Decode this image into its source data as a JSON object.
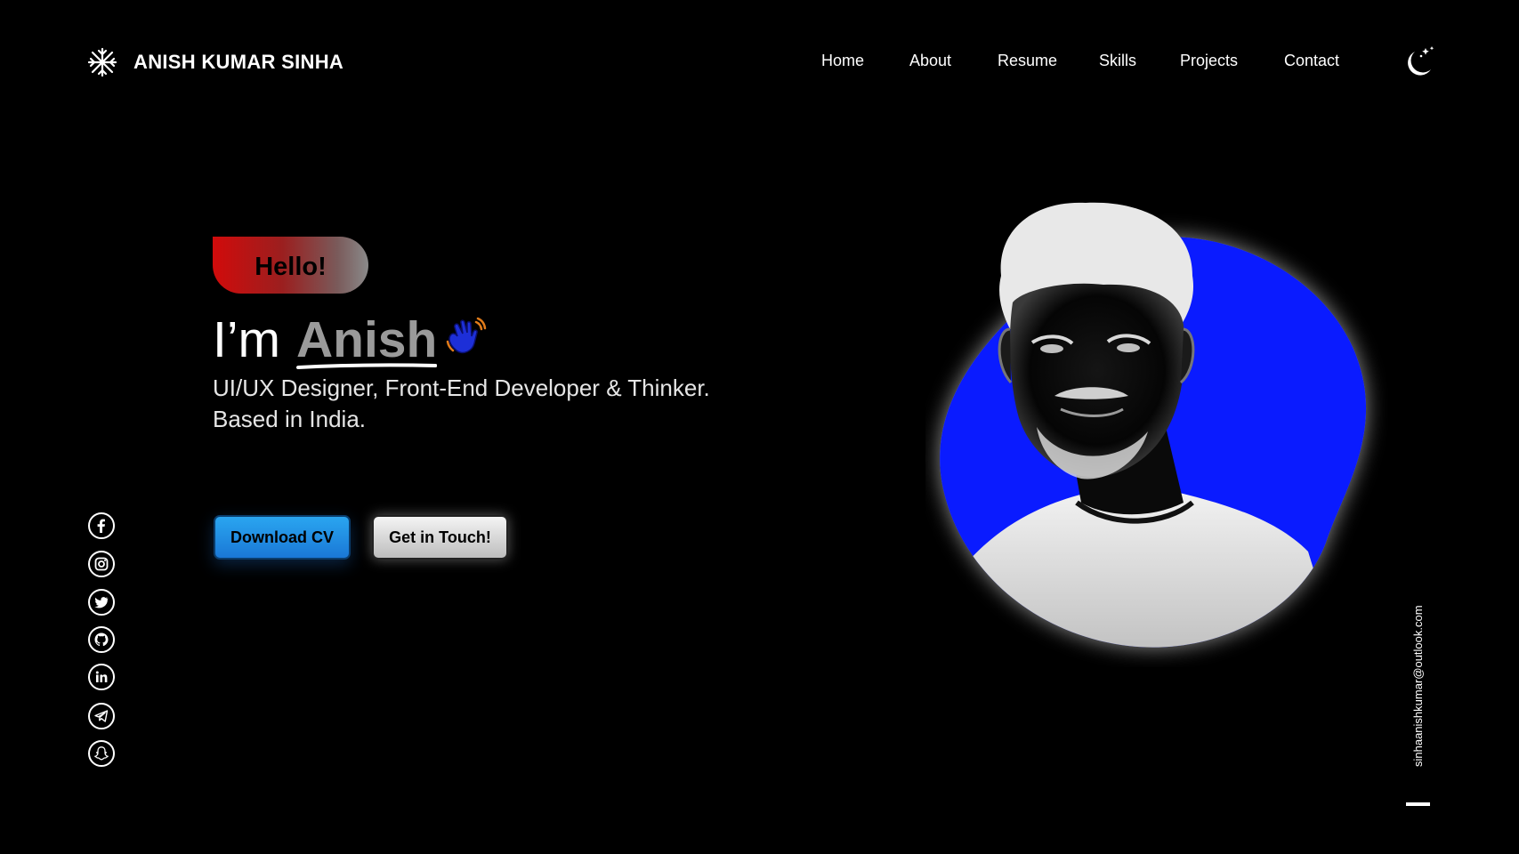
{
  "header": {
    "logo_icon": "snowflake-icon",
    "brand": "ANISH KUMAR SINHA",
    "nav": [
      "Home",
      "About",
      "Resume",
      "Skills",
      "Projects",
      "Contact"
    ],
    "theme_icon": "moon-stars-icon"
  },
  "hero": {
    "greeting": "Hello!",
    "intro": "I’m",
    "name": "Anish",
    "wave_icon": "waving-hand-icon",
    "tagline_1": "UI/UX Designer, Front-End Developer & Thinker.",
    "tagline_2": "Based in India.",
    "download_label": "Download CV",
    "contact_label": "Get in Touch!"
  },
  "social": [
    "facebook-icon",
    "instagram-icon",
    "twitter-icon",
    "github-icon",
    "linkedin-icon",
    "telegram-icon",
    "snapchat-icon"
  ],
  "email": "sinhaanishkumar@outlook.com",
  "colors": {
    "accent_blue": "#0a1bff",
    "button_blue": "#1f8ee6",
    "hello_red": "#d10b0b"
  }
}
